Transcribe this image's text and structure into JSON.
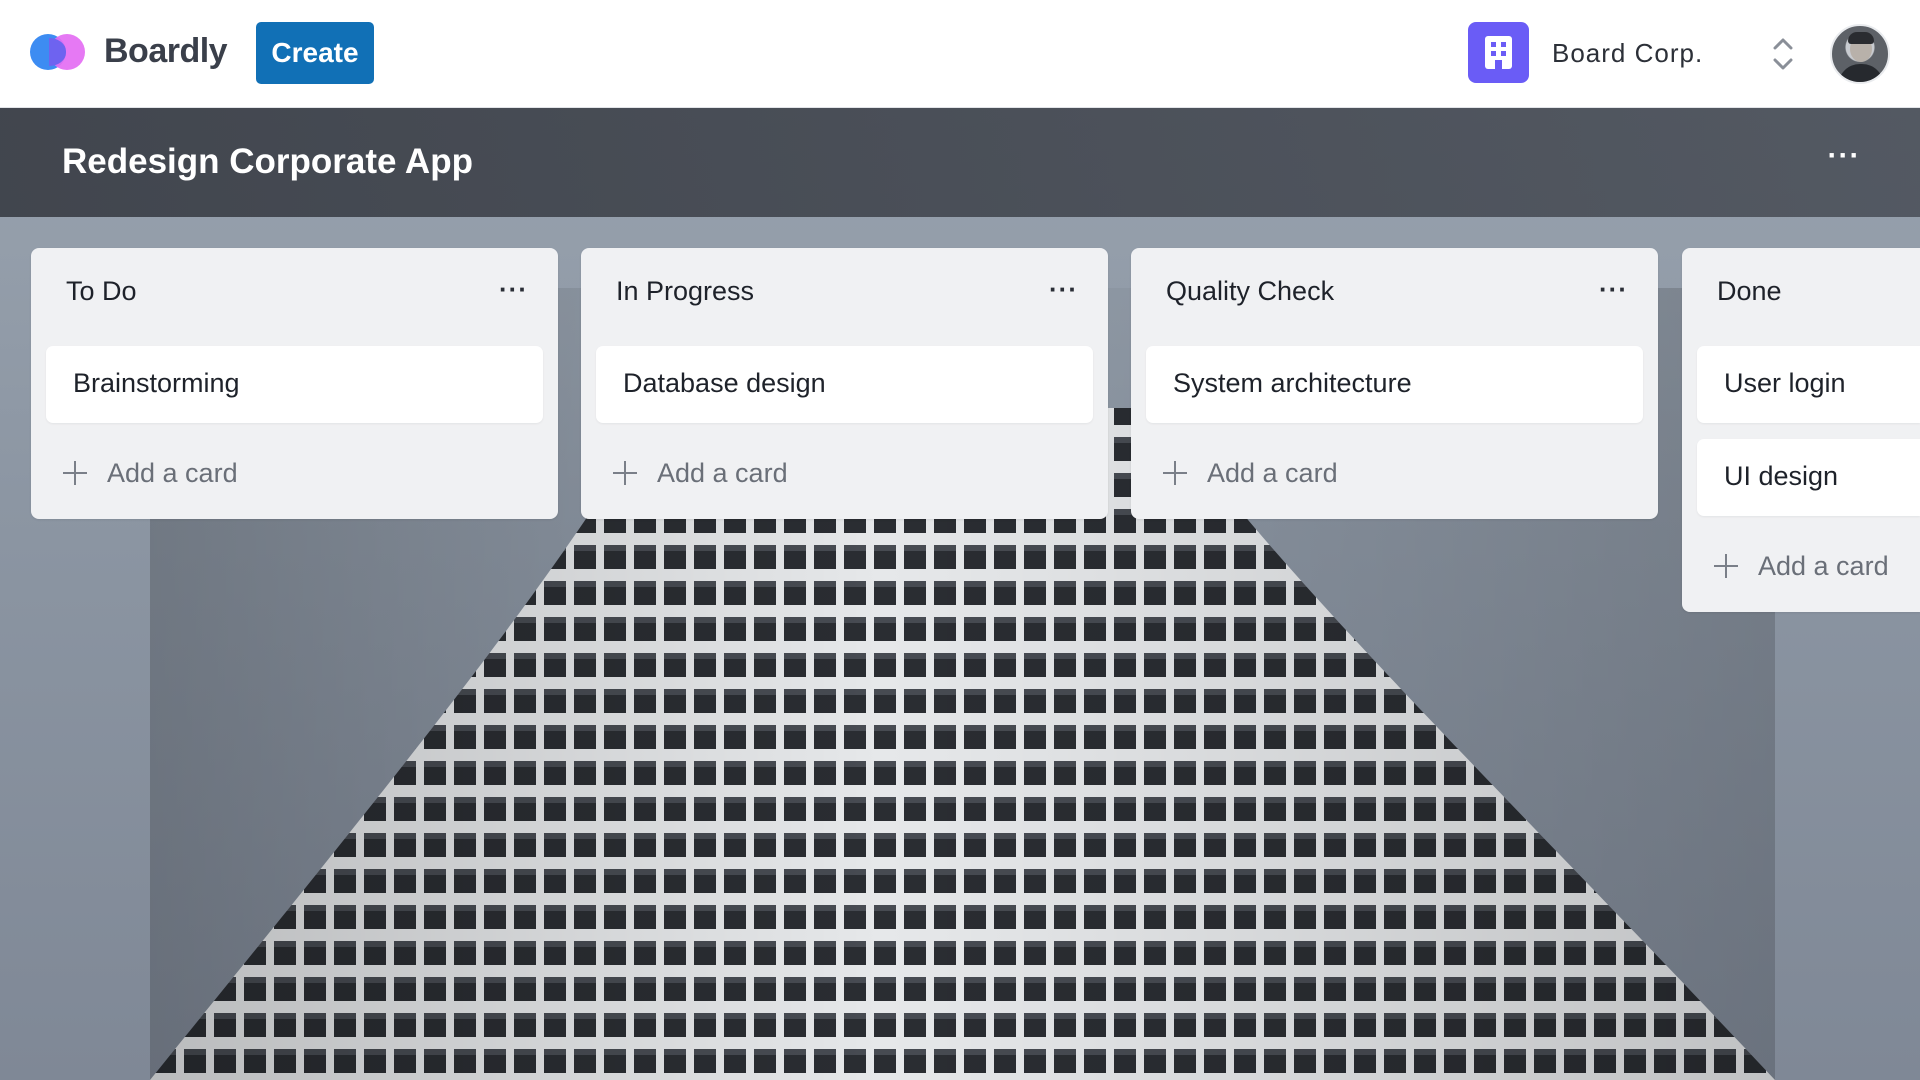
{
  "app": {
    "brand": "Boardly",
    "create_label": "Create",
    "org_name": "Board Corp.",
    "colors": {
      "create_button": "#1170b6",
      "org_icon": "#6a5cf6",
      "logo_blue": "#3d8cf2",
      "logo_pink": "#e46ef3"
    }
  },
  "board": {
    "title": "Redesign Corporate App",
    "menu_label": "···",
    "lists": [
      {
        "title": "To Do",
        "menu_label": "···",
        "cards": [
          "Brainstorming"
        ],
        "add_label": "Add a card"
      },
      {
        "title": "In Progress",
        "menu_label": "···",
        "cards": [
          "Database design"
        ],
        "add_label": "Add a card"
      },
      {
        "title": "Quality Check",
        "menu_label": "···",
        "cards": [
          "System architecture"
        ],
        "add_label": "Add a card"
      },
      {
        "title": "Done",
        "menu_label": "···",
        "cards": [
          "User login",
          "UI design"
        ],
        "add_label": "Add a card"
      }
    ]
  },
  "icons": {
    "logo": "boardly-logo-icon",
    "org": "building-icon",
    "switcher": "chevron-up-down-icon",
    "plus": "plus-icon",
    "menu": "more-horizontal-icon"
  }
}
